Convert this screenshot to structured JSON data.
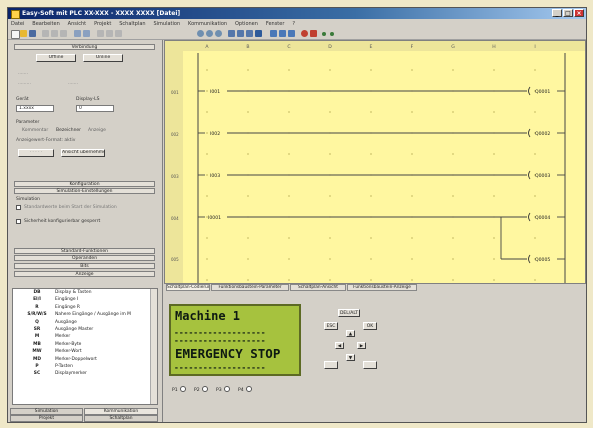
{
  "window": {
    "title": "Easy-Soft mit PLC XX-XXX - XXXX XXXX [Datei]"
  },
  "menubar": [
    "Datei",
    "Bearbeiten",
    "Ansicht",
    "Projekt",
    "Schaltplan",
    "Simulation",
    "Kommunikation",
    "Optionen",
    "Fenster",
    "?"
  ],
  "ladder": {
    "columns": [
      "A",
      "B",
      "C",
      "D",
      "E",
      "F",
      "G",
      "H",
      "I"
    ],
    "rungs": [
      {
        "num": "001",
        "contact": "I001",
        "coil": "Q0001"
      },
      {
        "num": "002",
        "contact": "I002",
        "coil": "Q0002"
      },
      {
        "num": "003",
        "contact": "I003",
        "coil": "Q0003"
      },
      {
        "num": "004",
        "contact": "I0001"
      },
      {
        "num": "005"
      }
    ],
    "coil_top": "Q0004",
    "coil_bottom": "Q0005"
  },
  "left_panel": {
    "top_header": "Verbindung",
    "btn_a": "Offline",
    "btn_b": "Online",
    "label_device": "Gerät",
    "label_display": "Display-LS",
    "device_value": "1.xxxx",
    "display_value": "0",
    "label_parameter": "Parameter",
    "opt1": "Kommentar",
    "opt2": "Bezeichner",
    "opt3": "Anzeige",
    "status_line": "Anzeigewert-Format: aktiv",
    "btn_lower": "Ansicht übernehmen",
    "mid_header1": "Konfiguration",
    "mid_header2": "Simulation-Einstellungen",
    "sim_label": "Simulation",
    "checkbox1": "Standardwerte beim Start der Simulation",
    "checkbox2": "Sicherheit konfigurierbar gesperrt",
    "bot_headers": [
      "Standard-Funktionen",
      "Operanden",
      "Bits",
      "Anzeige"
    ],
    "list": [
      {
        "code": "DB",
        "desc": "Display & Tasten"
      },
      {
        "code": "EI/I",
        "desc": "Eingänge I"
      },
      {
        "code": "R",
        "desc": "Eingänge R"
      },
      {
        "code": "S/R/W/S",
        "desc": "Nahere Eingänge / Ausgänge im M"
      },
      {
        "code": "Q",
        "desc": "Ausgänge"
      },
      {
        "code": "SR",
        "desc": "Ausgänge Master"
      },
      {
        "code": "M",
        "desc": "Merker"
      },
      {
        "code": "MB",
        "desc": "Merker-Byte"
      },
      {
        "code": "MW",
        "desc": "Merker-Wort"
      },
      {
        "code": "MD",
        "desc": "Merker-Doppelwort"
      },
      {
        "code": "P",
        "desc": "P-Tasten"
      },
      {
        "code": "SC",
        "desc": "Displaymerker"
      }
    ],
    "bottom_tabs": [
      "Simulation",
      "Kommunikation",
      "Projekt",
      "Schaltplan"
    ]
  },
  "editor_tabs": [
    "Schaltplan-Codierung",
    "Funktionsbaustein-Parameter",
    "Schaltplan-Ansicht",
    "Funktionsbaustein-Anzeige"
  ],
  "lcd": {
    "line1": "Machine 1",
    "dashes": "-------------------",
    "line3": "EMERGENCY STOP"
  },
  "keypad": {
    "del_label": "DEL/ALT",
    "esc_label": "ESC",
    "ok_label": "OK"
  },
  "radios": [
    "P1",
    "P2",
    "P3",
    "P4"
  ]
}
